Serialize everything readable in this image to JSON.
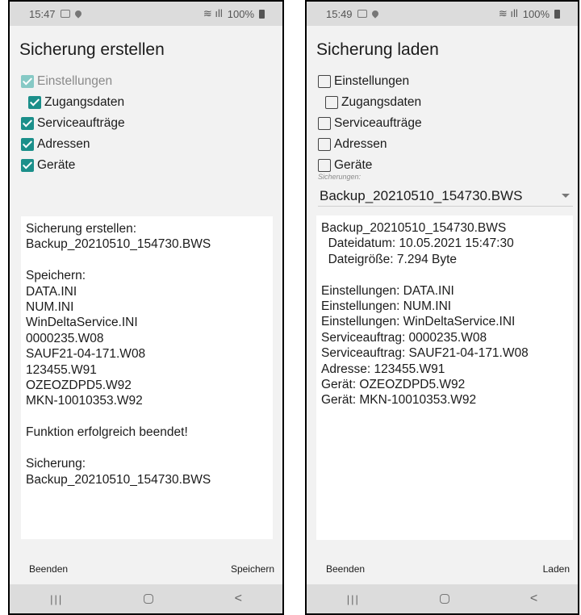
{
  "left": {
    "status": {
      "time": "15:47",
      "battery": "100%"
    },
    "title": "Sicherung erstellen",
    "checkboxes": [
      {
        "label": "Einstellungen",
        "checked": true,
        "dim": true,
        "indent": false
      },
      {
        "label": "Zugangsdaten",
        "checked": true,
        "dim": false,
        "indent": true
      },
      {
        "label": "Serviceaufträge",
        "checked": true,
        "dim": false,
        "indent": false
      },
      {
        "label": "Adressen",
        "checked": true,
        "dim": false,
        "indent": false
      },
      {
        "label": "Geräte",
        "checked": true,
        "dim": false,
        "indent": false
      }
    ],
    "output_text": "Sicherung erstellen:\nBackup_20210510_154730.BWS\n\nSpeichern:\nDATA.INI\nNUM.INI\nWinDeltaService.INI\n0000235.W08\nSAUF21-04-171.W08\n123455.W91\nOZEOZDPD5.W92\nMKN-10010353.W92\n\nFunktion erfolgreich beendet!\n\nSicherung:\nBackup_20210510_154730.BWS",
    "footer": {
      "left": "Beenden",
      "right": "Speichern"
    }
  },
  "right": {
    "status": {
      "time": "15:49",
      "battery": "100%"
    },
    "title": "Sicherung laden",
    "checkboxes": [
      {
        "label": "Einstellungen",
        "checked": false,
        "dim": false,
        "indent": false
      },
      {
        "label": "Zugangsdaten",
        "checked": false,
        "dim": false,
        "indent": true
      },
      {
        "label": "Serviceaufträge",
        "checked": false,
        "dim": false,
        "indent": false
      },
      {
        "label": "Adressen",
        "checked": false,
        "dim": false,
        "indent": false
      },
      {
        "label": "Geräte",
        "checked": false,
        "dim": false,
        "indent": false
      }
    ],
    "select": {
      "label": "Sicherungen:",
      "value": "Backup_20210510_154730.BWS"
    },
    "output_text": "Backup_20210510_154730.BWS\n  Dateidatum: 10.05.2021 15:47:30\n  Dateigröße: 7.294 Byte\n\nEinstellungen: DATA.INI\nEinstellungen: NUM.INI\nEinstellungen: WinDeltaService.INI\nServiceauftrag: 0000235.W08\nServiceauftrag: SAUF21-04-171.W08\nAdresse: 123455.W91\nGerät: OZEOZDPD5.W92\nGerät: MKN-10010353.W92",
    "footer": {
      "left": "Beenden",
      "right": "Laden"
    }
  },
  "nav": {
    "recent": "|||",
    "back": "<"
  },
  "colors": {
    "accent": "#1b8f8a",
    "accent_disabled": "#86c9c5"
  }
}
